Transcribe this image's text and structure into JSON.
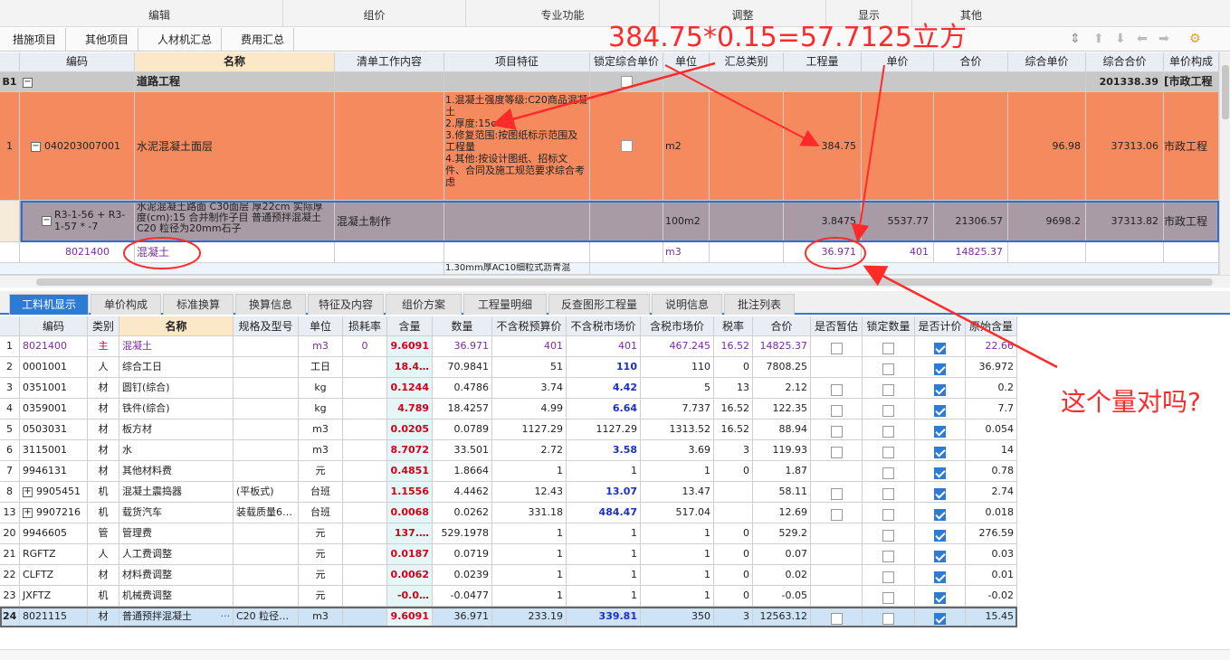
{
  "menu": {
    "groups": [
      "编辑",
      "组价",
      "专业功能",
      "调整",
      "显示",
      "其他"
    ]
  },
  "ribbon": {
    "tabs": [
      "措施项目",
      "其他项目",
      "人材机汇总",
      "费用汇总"
    ]
  },
  "grid1": {
    "headers": [
      "编码",
      "名称",
      "清单工作内容",
      "项目特征",
      "锁定综合单价",
      "单位",
      "汇总类别",
      "工程量",
      "单价",
      "合价",
      "综合单价",
      "综合合价",
      "单价构成"
    ],
    "rows": {
      "b1": {
        "idx": "B1",
        "name": "道路工程",
        "zhhj": "201338.39",
        "djgc": "[市政工程"
      },
      "r1": {
        "idx": "1",
        "code": "040203007001",
        "name": "水泥混凝土面层",
        "feature": "1.混凝土强度等级:C20商品混凝土\n2.厚度:15cm\n3.修复范围:按图纸标示范围及工程量\n4.其他:按设计图纸、招标文件、合同及施工规范要求综合考虑",
        "unit": "m2",
        "qty": "384.75",
        "zhdj": "96.98",
        "zhhj": "37313.06",
        "djgc": "市政工程"
      },
      "r2": {
        "code": "R3-1-56 + R3-1-57 * -7",
        "name": "水泥混凝土路面 C30面层 厚22cm  实际厚度(cm):15  合并制作子目 普通预拌混凝土 C20 粒径为20mm石子",
        "work": "混凝土制作",
        "unit": "100m2",
        "qty": "3.8475",
        "dj": "5537.77",
        "hj": "21306.57",
        "zhdj": "9698.2",
        "zhhj": "37313.82",
        "djgc": "市政工程"
      },
      "r3": {
        "code": "8021400",
        "name": "混凝土",
        "unit": "m3",
        "qty": "36.971",
        "dj": "401",
        "hj": "14825.37"
      },
      "r4": {
        "feature": "1.30mm厚AC10细粒式沥青混"
      }
    }
  },
  "tabs": [
    "工料机显示",
    "单价构成",
    "标准换算",
    "换算信息",
    "特征及内容",
    "组价方案",
    "工程量明细",
    "反查图形工程量",
    "说明信息",
    "批注列表"
  ],
  "grid2": {
    "headers": [
      "编码",
      "类别",
      "名称",
      "规格及型号",
      "单位",
      "损耗率",
      "含量",
      "数量",
      "不含税预算价",
      "不含税市场价",
      "含税市场价",
      "税率",
      "合价",
      "是否暂估",
      "锁定数量",
      "是否计价",
      "原始含量"
    ],
    "rows": [
      {
        "idx": "1",
        "code": "8021400",
        "type": "主",
        "name": "混凝土",
        "spec": "",
        "unit": "m3",
        "loss": "0",
        "content": "9.6091",
        "qty": "36.971",
        "p1": "401",
        "p2": "401",
        "p3": "467.245",
        "tax": "16.52",
        "total": "14825.37",
        "orig": "22.66",
        "purple": true
      },
      {
        "idx": "2",
        "code": "0001001",
        "type": "人",
        "name": "综合工日",
        "spec": "",
        "unit": "工日",
        "loss": "",
        "content": "18.4…",
        "qty": "70.9841",
        "p1": "51",
        "p2": "110",
        "p3": "110",
        "tax": "0",
        "total": "7808.25",
        "orig": "36.972"
      },
      {
        "idx": "3",
        "code": "0351001",
        "type": "材",
        "name": "圆钉(综合)",
        "spec": "",
        "unit": "kg",
        "loss": "",
        "content": "0.1244",
        "qty": "0.4786",
        "p1": "3.74",
        "p2": "4.42",
        "p3": "5",
        "tax": "13",
        "total": "2.12",
        "orig": "0.2"
      },
      {
        "idx": "4",
        "code": "0359001",
        "type": "材",
        "name": "铁件(综合)",
        "spec": "",
        "unit": "kg",
        "loss": "",
        "content": "4.789",
        "qty": "18.4257",
        "p1": "4.99",
        "p2": "6.64",
        "p3": "7.737",
        "tax": "16.52",
        "total": "122.35",
        "orig": "7.7"
      },
      {
        "idx": "5",
        "code": "0503031",
        "type": "材",
        "name": "板方材",
        "spec": "",
        "unit": "m3",
        "loss": "",
        "content": "0.0205",
        "qty": "0.0789",
        "p1": "1127.29",
        "p2": "1127.29",
        "p3": "1313.52",
        "tax": "16.52",
        "total": "88.94",
        "orig": "0.054"
      },
      {
        "idx": "6",
        "code": "3115001",
        "type": "材",
        "name": "水",
        "spec": "",
        "unit": "m3",
        "loss": "",
        "content": "8.7072",
        "qty": "33.501",
        "p1": "2.72",
        "p2": "3.58",
        "p3": "3.69",
        "tax": "3",
        "total": "119.93",
        "orig": "14"
      },
      {
        "idx": "7",
        "code": "9946131",
        "type": "材",
        "name": "其他材料费",
        "spec": "",
        "unit": "元",
        "loss": "",
        "content": "0.4851",
        "qty": "1.8664",
        "p1": "1",
        "p2": "1",
        "p3": "1",
        "tax": "0",
        "total": "1.87",
        "orig": "0.78"
      },
      {
        "idx": "8",
        "code": "9905451",
        "type": "机",
        "name": "混凝土震捣器",
        "spec": "(平板式)",
        "unit": "台班",
        "loss": "",
        "content": "1.1556",
        "qty": "4.4462",
        "p1": "12.43",
        "p2": "13.07",
        "p3": "13.47",
        "tax": "",
        "total": "58.11",
        "orig": "2.74",
        "expand": true
      },
      {
        "idx": "13",
        "code": "9907216",
        "type": "机",
        "name": "载货汽车",
        "spec": "装载质量6…",
        "unit": "台班",
        "loss": "",
        "content": "0.0068",
        "qty": "0.0262",
        "p1": "331.18",
        "p2": "484.47",
        "p3": "517.04",
        "tax": "",
        "total": "12.69",
        "orig": "0.018",
        "expand": true
      },
      {
        "idx": "20",
        "code": "9946605",
        "type": "管",
        "name": "管理费",
        "spec": "",
        "unit": "元",
        "loss": "",
        "content": "137.…",
        "qty": "529.1978",
        "p1": "1",
        "p2": "1",
        "p3": "1",
        "tax": "0",
        "total": "529.2",
        "orig": "276.59"
      },
      {
        "idx": "21",
        "code": "RGFTZ",
        "type": "人",
        "name": "人工费调整",
        "spec": "",
        "unit": "元",
        "loss": "",
        "content": "0.0187",
        "qty": "0.0719",
        "p1": "1",
        "p2": "1",
        "p3": "1",
        "tax": "0",
        "total": "0.07",
        "orig": "0.03"
      },
      {
        "idx": "22",
        "code": "CLFTZ",
        "type": "材",
        "name": "材料费调整",
        "spec": "",
        "unit": "元",
        "loss": "",
        "content": "0.0062",
        "qty": "0.0239",
        "p1": "1",
        "p2": "1",
        "p3": "1",
        "tax": "0",
        "total": "0.02",
        "orig": "0.01"
      },
      {
        "idx": "23",
        "code": "JXFTZ",
        "type": "机",
        "name": "机械费调整",
        "spec": "",
        "unit": "元",
        "loss": "",
        "content": "-0.0…",
        "qty": "-0.0477",
        "p1": "1",
        "p2": "1",
        "p3": "1",
        "tax": "0",
        "total": "-0.05",
        "orig": "-0.02"
      },
      {
        "idx": "24",
        "code": "8021115",
        "type": "材",
        "name": "普通预拌混凝土",
        "spec": "C20 粒径…",
        "unit": "m3",
        "loss": "",
        "content": "9.6091",
        "qty": "36.971",
        "p1": "233.19",
        "p2": "339.81",
        "p3": "350",
        "tax": "3",
        "total": "12563.12",
        "orig": "15.45",
        "selected": true
      }
    ]
  },
  "annotations": {
    "formula": "384.75*0.15=57.7125立方",
    "question": "这个量对吗?"
  },
  "colors": {
    "accent": "#2e7bd6",
    "annotation": "#ff2a2a",
    "row1": "#f58a5e",
    "row2": "#a89ba6"
  }
}
